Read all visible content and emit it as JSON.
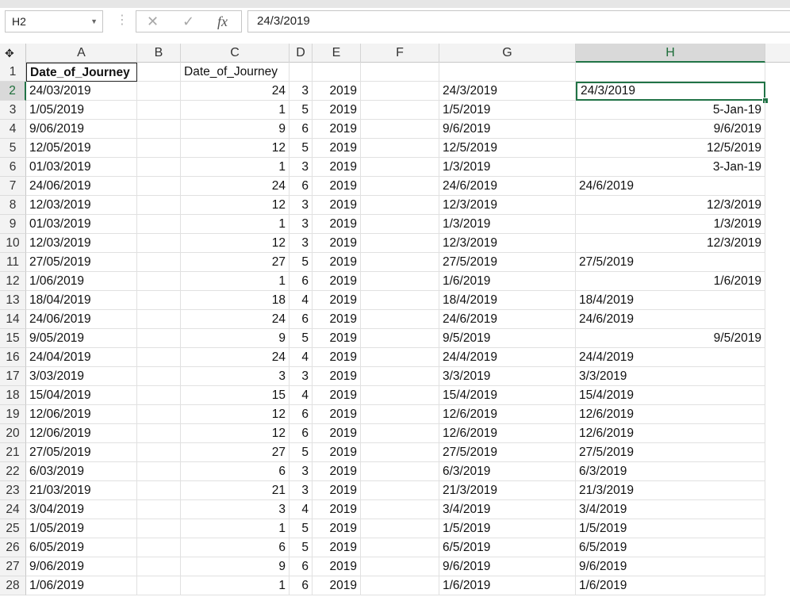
{
  "formula_bar": {
    "name_box": "H2",
    "content": "24/3/2019",
    "cancel_icon": "x-icon",
    "enter_icon": "check-icon",
    "function_icon": "fx-icon",
    "function_label": "fx"
  },
  "grid": {
    "selected_cell": "H2",
    "columns": [
      "A",
      "B",
      "C",
      "D",
      "E",
      "F",
      "G",
      "H"
    ],
    "rows": [
      {
        "n": "1",
        "A": "Date_of_Journey",
        "B": "",
        "C": "Date_of_Journey",
        "D": "",
        "E": "",
        "F": "",
        "G": "",
        "H": ""
      },
      {
        "n": "2",
        "A": "24/03/2019",
        "B": "",
        "C": "24",
        "D": "3",
        "E": "2019",
        "F": "",
        "G": "24/3/2019",
        "H": "24/3/2019"
      },
      {
        "n": "3",
        "A": "1/05/2019",
        "B": "",
        "C": "1",
        "D": "5",
        "E": "2019",
        "F": "",
        "G": "1/5/2019",
        "H": "5-Jan-19"
      },
      {
        "n": "4",
        "A": "9/06/2019",
        "B": "",
        "C": "9",
        "D": "6",
        "E": "2019",
        "F": "",
        "G": "9/6/2019",
        "H": "9/6/2019"
      },
      {
        "n": "5",
        "A": "12/05/2019",
        "B": "",
        "C": "12",
        "D": "5",
        "E": "2019",
        "F": "",
        "G": "12/5/2019",
        "H": "12/5/2019"
      },
      {
        "n": "6",
        "A": "01/03/2019",
        "B": "",
        "C": "1",
        "D": "3",
        "E": "2019",
        "F": "",
        "G": "1/3/2019",
        "H": "3-Jan-19"
      },
      {
        "n": "7",
        "A": "24/06/2019",
        "B": "",
        "C": "24",
        "D": "6",
        "E": "2019",
        "F": "",
        "G": "24/6/2019",
        "H": "24/6/2019"
      },
      {
        "n": "8",
        "A": "12/03/2019",
        "B": "",
        "C": "12",
        "D": "3",
        "E": "2019",
        "F": "",
        "G": "12/3/2019",
        "H": "12/3/2019"
      },
      {
        "n": "9",
        "A": "01/03/2019",
        "B": "",
        "C": "1",
        "D": "3",
        "E": "2019",
        "F": "",
        "G": "1/3/2019",
        "H": "1/3/2019"
      },
      {
        "n": "10",
        "A": "12/03/2019",
        "B": "",
        "C": "12",
        "D": "3",
        "E": "2019",
        "F": "",
        "G": "12/3/2019",
        "H": "12/3/2019"
      },
      {
        "n": "11",
        "A": "27/05/2019",
        "B": "",
        "C": "27",
        "D": "5",
        "E": "2019",
        "F": "",
        "G": "27/5/2019",
        "H": "27/5/2019"
      },
      {
        "n": "12",
        "A": "1/06/2019",
        "B": "",
        "C": "1",
        "D": "6",
        "E": "2019",
        "F": "",
        "G": "1/6/2019",
        "H": "1/6/2019"
      },
      {
        "n": "13",
        "A": "18/04/2019",
        "B": "",
        "C": "18",
        "D": "4",
        "E": "2019",
        "F": "",
        "G": "18/4/2019",
        "H": "18/4/2019"
      },
      {
        "n": "14",
        "A": "24/06/2019",
        "B": "",
        "C": "24",
        "D": "6",
        "E": "2019",
        "F": "",
        "G": "24/6/2019",
        "H": "24/6/2019"
      },
      {
        "n": "15",
        "A": "9/05/2019",
        "B": "",
        "C": "9",
        "D": "5",
        "E": "2019",
        "F": "",
        "G": "9/5/2019",
        "H": "9/5/2019"
      },
      {
        "n": "16",
        "A": "24/04/2019",
        "B": "",
        "C": "24",
        "D": "4",
        "E": "2019",
        "F": "",
        "G": "24/4/2019",
        "H": "24/4/2019"
      },
      {
        "n": "17",
        "A": "3/03/2019",
        "B": "",
        "C": "3",
        "D": "3",
        "E": "2019",
        "F": "",
        "G": "3/3/2019",
        "H": "3/3/2019"
      },
      {
        "n": "18",
        "A": "15/04/2019",
        "B": "",
        "C": "15",
        "D": "4",
        "E": "2019",
        "F": "",
        "G": "15/4/2019",
        "H": "15/4/2019"
      },
      {
        "n": "19",
        "A": "12/06/2019",
        "B": "",
        "C": "12",
        "D": "6",
        "E": "2019",
        "F": "",
        "G": "12/6/2019",
        "H": "12/6/2019"
      },
      {
        "n": "20",
        "A": "12/06/2019",
        "B": "",
        "C": "12",
        "D": "6",
        "E": "2019",
        "F": "",
        "G": "12/6/2019",
        "H": "12/6/2019"
      },
      {
        "n": "21",
        "A": "27/05/2019",
        "B": "",
        "C": "27",
        "D": "5",
        "E": "2019",
        "F": "",
        "G": "27/5/2019",
        "H": "27/5/2019"
      },
      {
        "n": "22",
        "A": "6/03/2019",
        "B": "",
        "C": "6",
        "D": "3",
        "E": "2019",
        "F": "",
        "G": "6/3/2019",
        "H": "6/3/2019"
      },
      {
        "n": "23",
        "A": "21/03/2019",
        "B": "",
        "C": "21",
        "D": "3",
        "E": "2019",
        "F": "",
        "G": "21/3/2019",
        "H": "21/3/2019"
      },
      {
        "n": "24",
        "A": "3/04/2019",
        "B": "",
        "C": "3",
        "D": "4",
        "E": "2019",
        "F": "",
        "G": "3/4/2019",
        "H": "3/4/2019"
      },
      {
        "n": "25",
        "A": "1/05/2019",
        "B": "",
        "C": "1",
        "D": "5",
        "E": "2019",
        "F": "",
        "G": "1/5/2019",
        "H": "1/5/2019"
      },
      {
        "n": "26",
        "A": "6/05/2019",
        "B": "",
        "C": "6",
        "D": "5",
        "E": "2019",
        "F": "",
        "G": "6/5/2019",
        "H": "6/5/2019"
      },
      {
        "n": "27",
        "A": "9/06/2019",
        "B": "",
        "C": "9",
        "D": "6",
        "E": "2019",
        "F": "",
        "G": "9/6/2019",
        "H": "9/6/2019"
      },
      {
        "n": "28",
        "A": "1/06/2019",
        "B": "",
        "C": "1",
        "D": "6",
        "E": "2019",
        "F": "",
        "G": "1/6/2019",
        "H": "1/6/2019"
      }
    ],
    "h_right_aligned_rows": [
      "3",
      "4",
      "5",
      "6",
      "8",
      "9",
      "10",
      "12",
      "15"
    ]
  }
}
